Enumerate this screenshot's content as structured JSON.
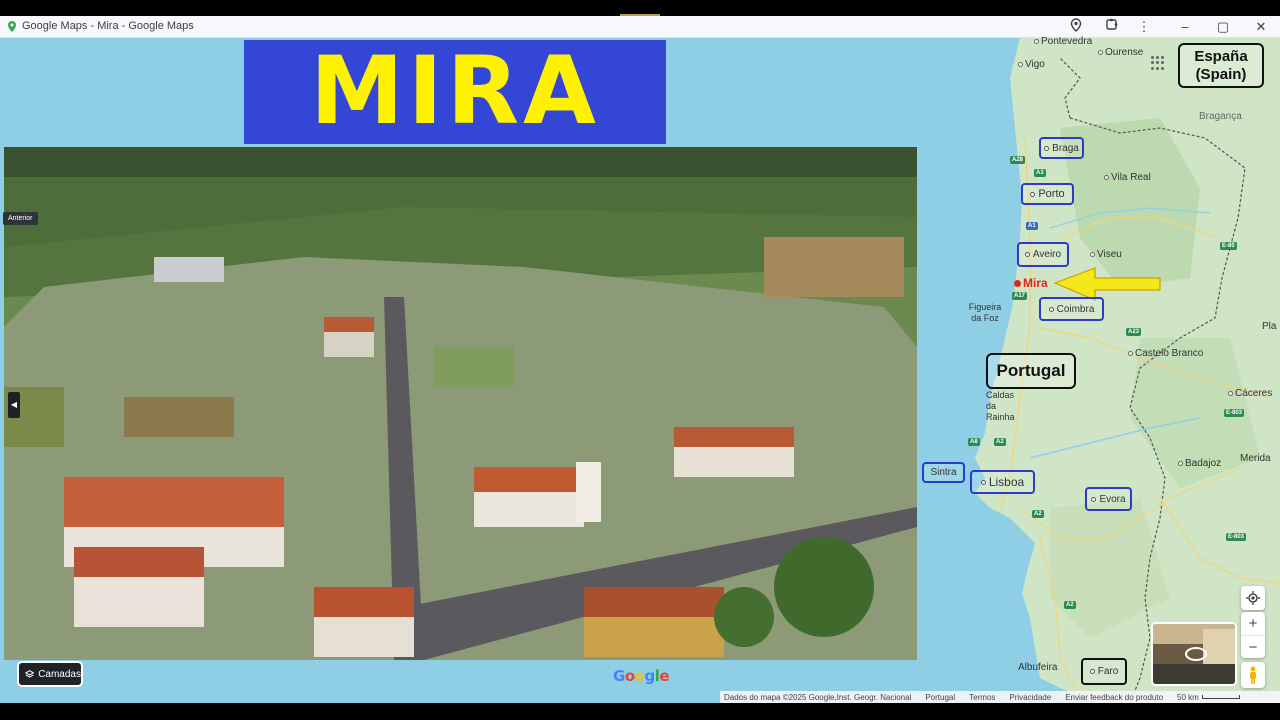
{
  "window": {
    "title": "Google Maps - Mira - Google Maps"
  },
  "banner": {
    "text": "MIRA"
  },
  "photo": {
    "prev_label": "Anterior"
  },
  "layers": {
    "label": "Camadas"
  },
  "map": {
    "highlight": "Mira",
    "cities_plain": [
      "Pontevedra",
      "Ourense",
      "Vigo",
      "Bragança",
      "Vila Real",
      "Viseu",
      "Figueira da Foz",
      "Castelo Branco",
      "Caldas da Rainha",
      "Cáceres",
      "Badajoz",
      "Merida",
      "Albufeira",
      "Pla"
    ],
    "cities_boxed": [
      "Braga",
      "Porto",
      "Aveiro",
      "Coimbra",
      "Sintra",
      "Lisboa",
      "Evora",
      "Faro"
    ],
    "countries": {
      "spain": "España\n(Spain)",
      "portugal": "Portugal"
    },
    "roads": [
      "A28",
      "A3",
      "A1",
      "A17",
      "A23",
      "A8",
      "A2",
      "E-80",
      "E-803",
      "E-803",
      "A2",
      "A2"
    ]
  },
  "footer": {
    "data": "Dados do mapa ©2025 Google,Inst. Geogr. Nacional",
    "country": "Portugal",
    "terms": "Termos",
    "privacy": "Privacidade",
    "feedback": "Enviar feedback do produto",
    "scale": "50 km"
  },
  "colors": {
    "banner_bg": "#3446d6",
    "banner_text": "#fff200",
    "box_blue": "#2e3ac0",
    "sea": "#8ecfe6",
    "land": "#cfe5c6",
    "arrow": "#f5e81a"
  }
}
